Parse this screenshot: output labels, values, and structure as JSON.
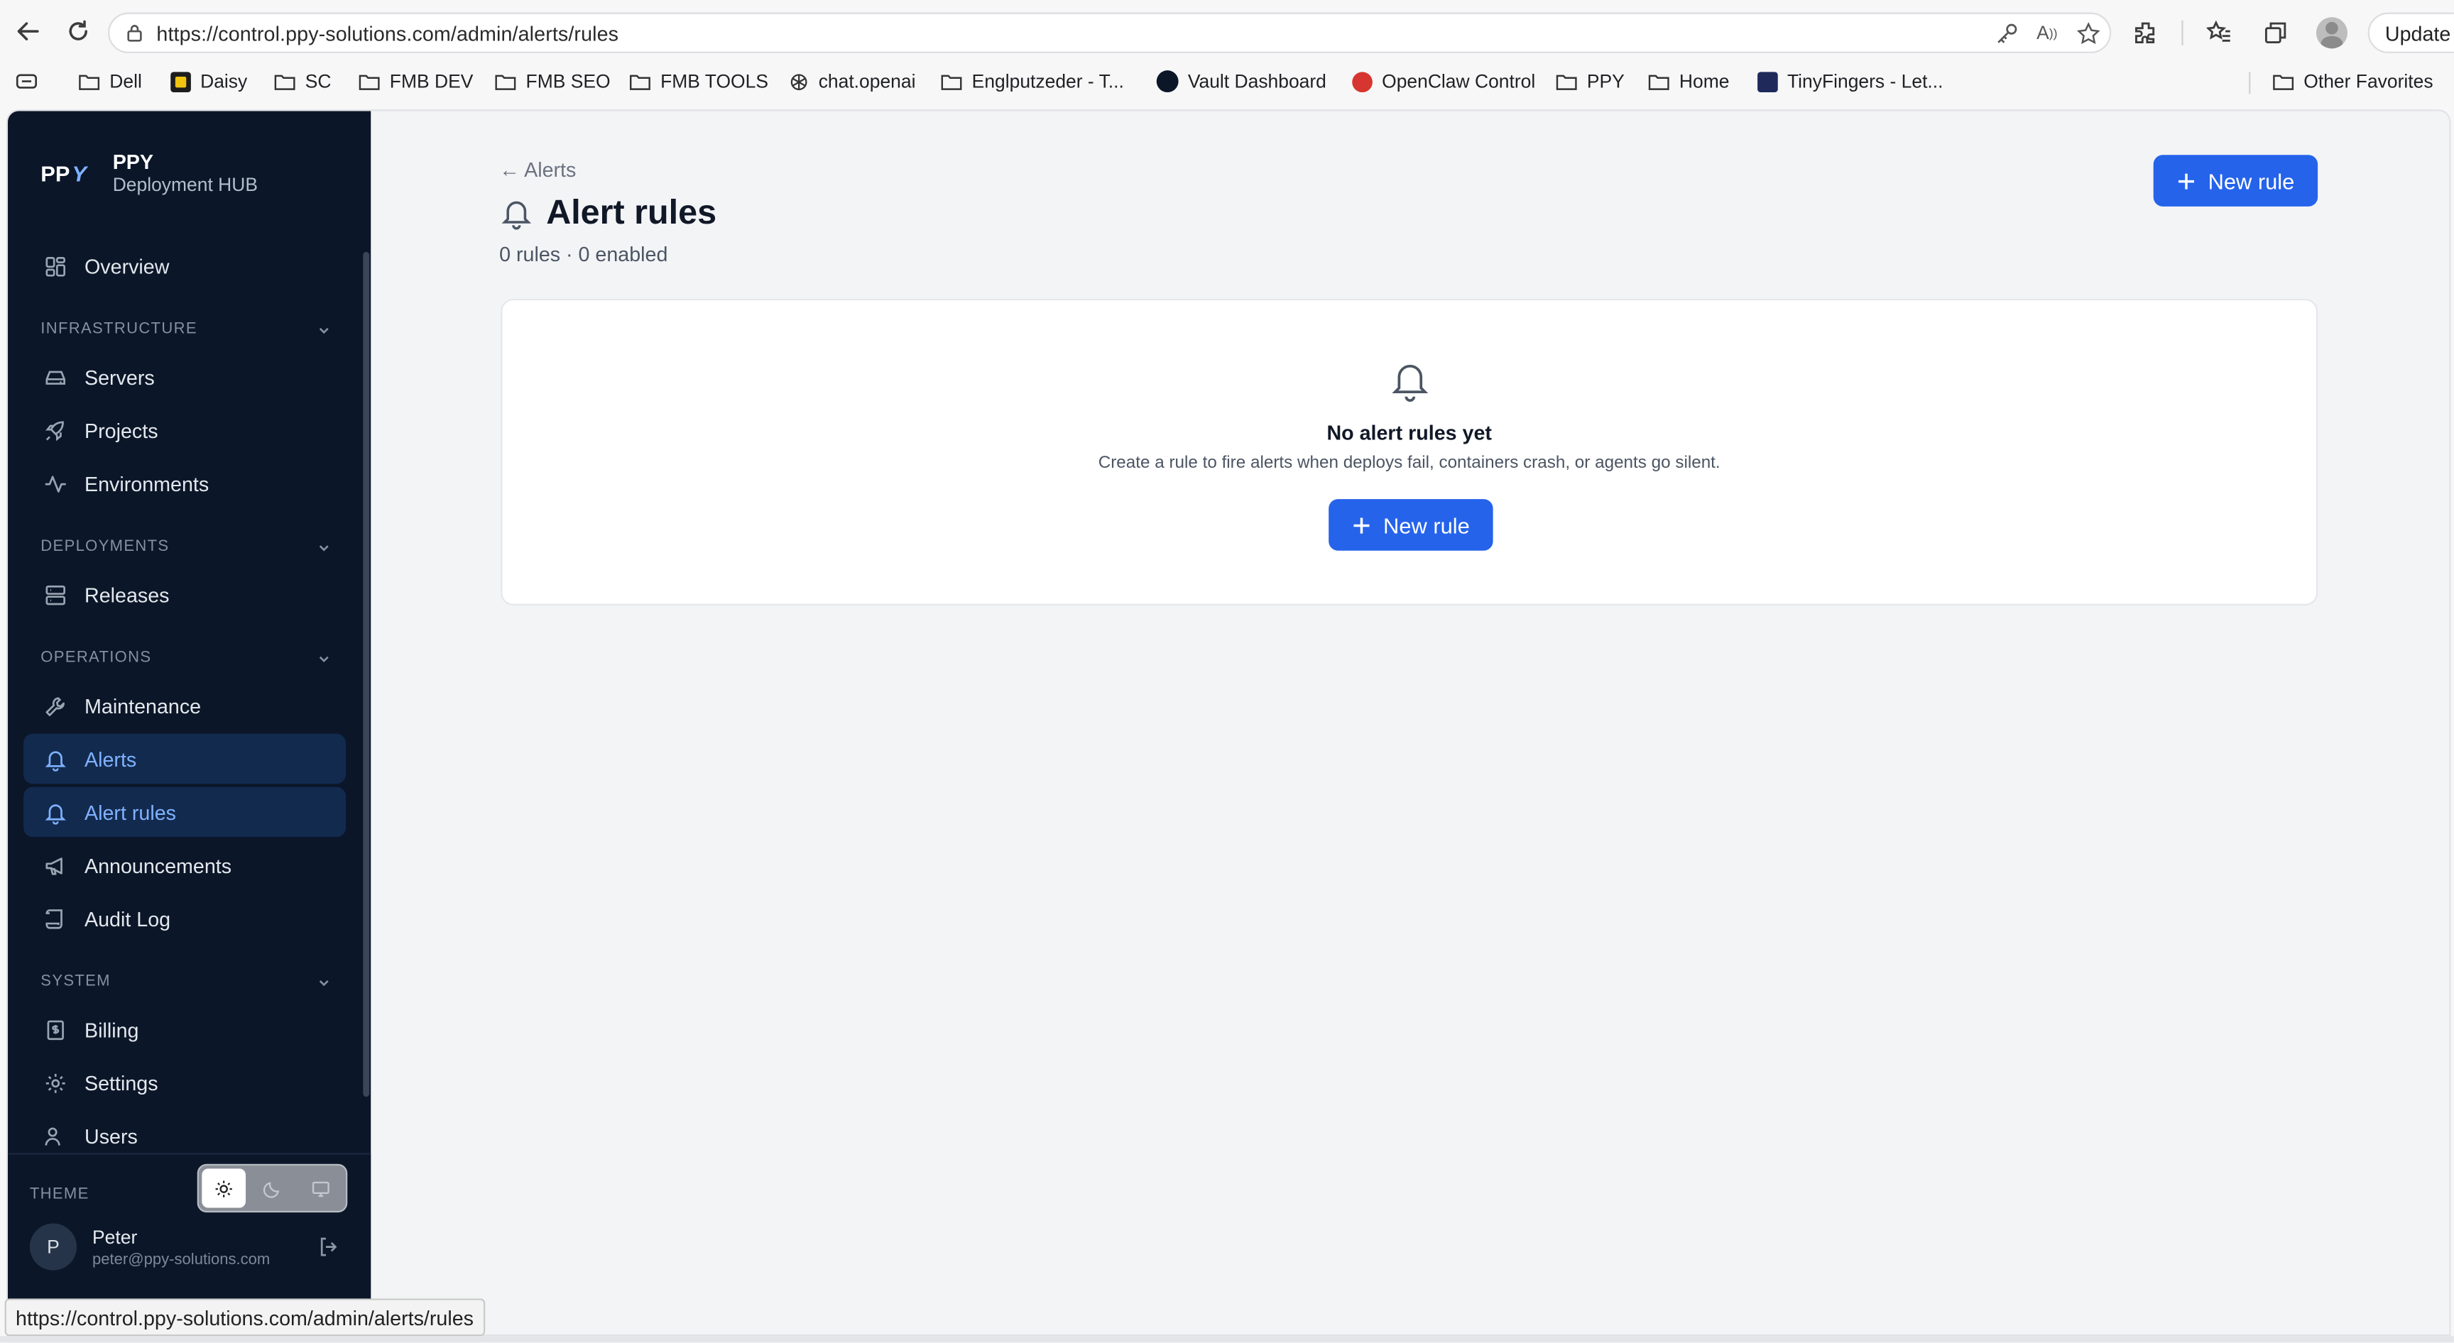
{
  "browser": {
    "url": "https://control.ppy-solutions.com/admin/alerts/rules",
    "update_label": "Update",
    "bookmarks": [
      {
        "label": "Dell",
        "icon": "folder-icon"
      },
      {
        "label": "Daisy",
        "icon": "daisy-favicon"
      },
      {
        "label": "SC",
        "icon": "folder-icon"
      },
      {
        "label": "FMB DEV",
        "icon": "folder-icon"
      },
      {
        "label": "FMB SEO",
        "icon": "folder-icon"
      },
      {
        "label": "FMB TOOLS",
        "icon": "folder-icon"
      },
      {
        "label": "chat.openai",
        "icon": "openai-favicon"
      },
      {
        "label": "Englputzeder - T...",
        "icon": "folder-icon"
      },
      {
        "label": "Vault Dashboard",
        "icon": "ppy-favicon"
      },
      {
        "label": "OpenClaw Control",
        "icon": "openclaw-favicon"
      },
      {
        "label": "PPY",
        "icon": "folder-icon"
      },
      {
        "label": "Home",
        "icon": "folder-icon"
      },
      {
        "label": "TinyFingers - Let...",
        "icon": "tinyfingers-favicon"
      }
    ],
    "other_favorites": "Other Favorites",
    "status_url": "https://control.ppy-solutions.com/admin/alerts/rules"
  },
  "sidebar": {
    "brand_name": "PPY",
    "brand_sub": "Deployment HUB",
    "overview": "Overview",
    "sections": {
      "infrastructure": "INFRASTRUCTURE",
      "deployments": "DEPLOYMENTS",
      "operations": "OPERATIONS",
      "system": "SYSTEM"
    },
    "items": {
      "servers": "Servers",
      "projects": "Projects",
      "environments": "Environments",
      "releases": "Releases",
      "maintenance": "Maintenance",
      "alerts": "Alerts",
      "alert_rules": "Alert rules",
      "announcements": "Announcements",
      "audit_log": "Audit Log",
      "billing": "Billing",
      "settings": "Settings",
      "users": "Users"
    },
    "theme_label": "THEME",
    "theme_selected": "light",
    "user": {
      "initial": "P",
      "name": "Peter",
      "email": "peter@ppy-solutions.com"
    }
  },
  "main": {
    "back_label": "← Alerts",
    "title": "Alert rules",
    "subtitle": "0 rules · 0 enabled",
    "new_rule_label": "New rule",
    "empty": {
      "title": "No alert rules yet",
      "description": "Create a rule to fire alerts when deploys fail, containers crash, or agents go silent.",
      "button_label": "New rule"
    }
  },
  "colors": {
    "accent": "#2563eb",
    "sidebar_bg": "#0b1628",
    "sidebar_active_bg": "#132a4f",
    "sidebar_active_text": "#7fb2ff"
  }
}
